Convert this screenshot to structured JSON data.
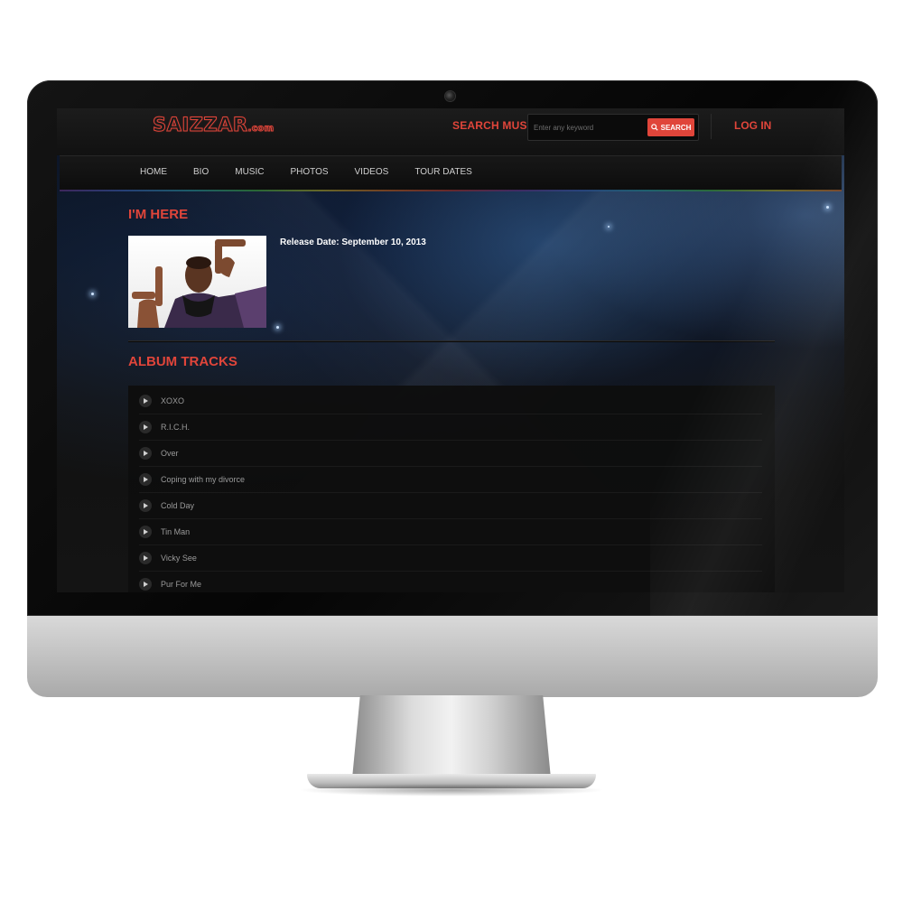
{
  "header": {
    "logo": "SAIZZAR",
    "logo_suffix": ".com",
    "search_label": "SEARCH MUSIC",
    "search_placeholder": "Enter any keyword",
    "search_button": "SEARCH",
    "login": "LOG IN"
  },
  "nav": {
    "items": [
      "HOME",
      "BIO",
      "MUSIC",
      "PHOTOS",
      "VIDEOS",
      "TOUR DATES"
    ]
  },
  "album": {
    "title": "I'M HERE",
    "release_date": "Release Date: September 10, 2013"
  },
  "tracks": {
    "title": "ALBUM TRACKS",
    "items": [
      "XOXO",
      "R.I.C.H.",
      "Over",
      "Coping with my divorce",
      "Cold Day",
      "Tin Man",
      "Vicky See",
      "Pur For Me"
    ]
  },
  "colors": {
    "accent": "#e0453a",
    "background": "#111111",
    "panel": "#0e0e0e"
  }
}
